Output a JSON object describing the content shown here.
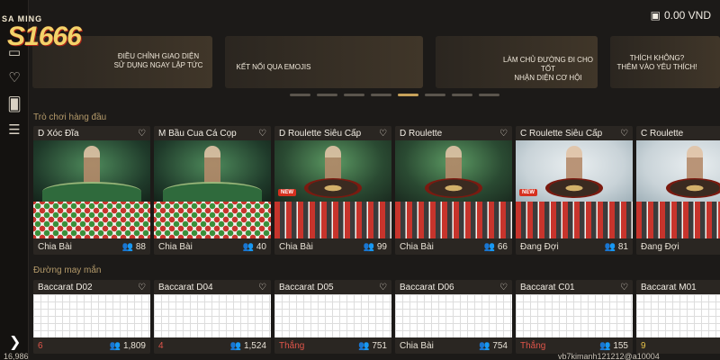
{
  "logo": {
    "top": "SA  MING",
    "brand": "S1666"
  },
  "wallet": {
    "amount": "0.00 VND"
  },
  "banners": [
    {
      "text": "ĐIỀU CHỈNH GIAO DIỆN\nSử dụng ngay lập tức"
    },
    {
      "text": "KẾT NỐI QUA EMOJIS"
    },
    {
      "text": "LÀM CHỦ ĐƯỜNG ĐI CHO TỐT\nNhận diện cơ hội"
    },
    {
      "text": "THÍCH KHÔNG?\nTHÊM VÀO YÊU THÍCH!"
    }
  ],
  "sections": {
    "top": "Trò chơi hàng đầu",
    "lucky": "Đường may mắn"
  },
  "games": [
    {
      "title": "D Xóc Đĩa",
      "status": "Chia Bài",
      "players": "88",
      "style": "dealer"
    },
    {
      "title": "M Bầu Cua Cá Cọp",
      "status": "Chia Bài",
      "players": "40",
      "style": "dealer"
    },
    {
      "title": "D Roulette Siêu Cấp",
      "status": "Chia Bài",
      "players": "99",
      "style": "roulette",
      "tag": "NEW"
    },
    {
      "title": "D Roulette",
      "status": "Chia Bài",
      "players": "66",
      "style": "roulette"
    },
    {
      "title": "C Roulette Siêu Cấp",
      "status": "Đang Đợi",
      "players": "81",
      "style": "light",
      "tag": "NEW"
    },
    {
      "title": "C Roulette",
      "status": "Đang Đợi",
      "players": "",
      "style": "light"
    }
  ],
  "baccarat": [
    {
      "title": "Baccarat D02",
      "left": "6",
      "players": "1,809"
    },
    {
      "title": "Baccarat D04",
      "left": "4",
      "players": "1,524"
    },
    {
      "title": "Baccarat D05",
      "left": "Thắng",
      "players": "751"
    },
    {
      "title": "Baccarat D06",
      "left": "Chia Bài",
      "players": "754"
    },
    {
      "title": "Baccarat C01",
      "left": "Thắng",
      "players": "155"
    },
    {
      "title": "Baccarat M01",
      "left": "9",
      "players": ""
    }
  ],
  "bottom": {
    "left": "16,986",
    "right": "vb7kimanh121212@a10004"
  }
}
